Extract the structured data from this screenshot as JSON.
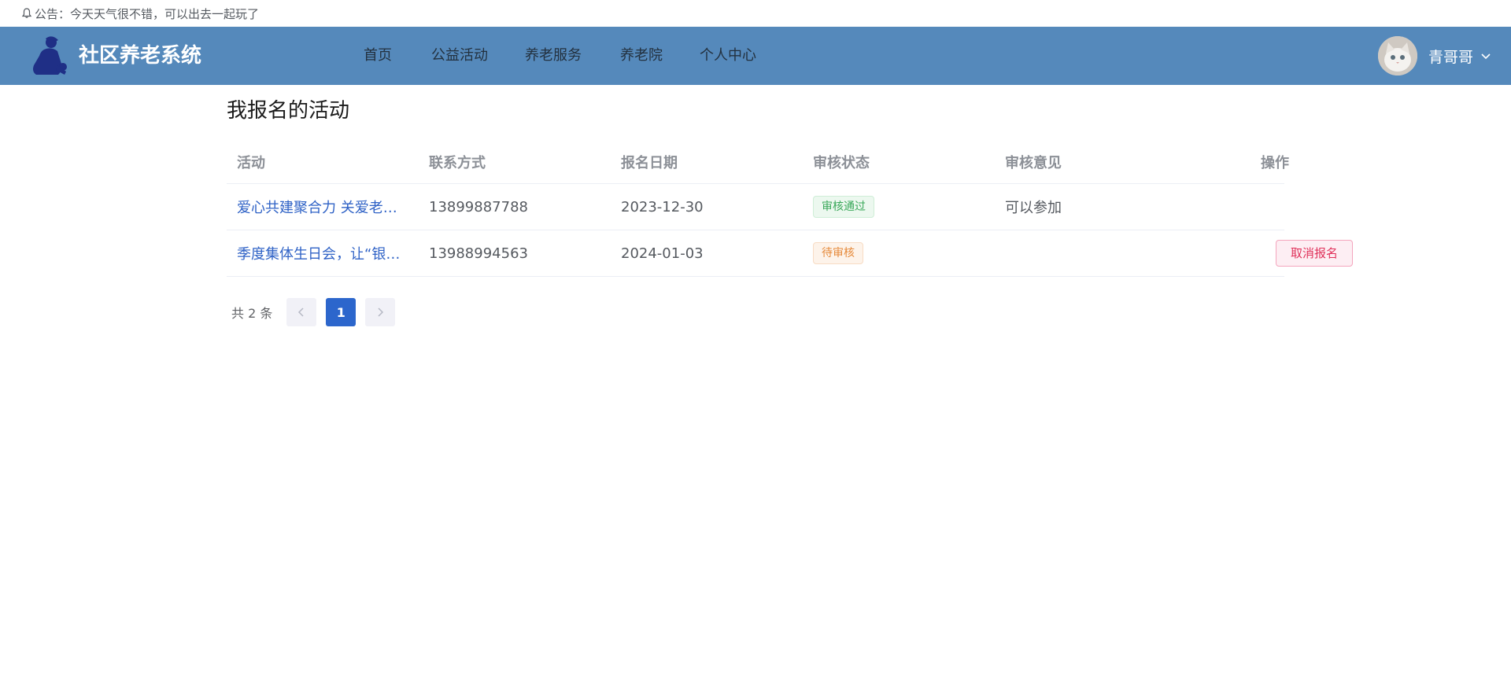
{
  "notice": {
    "prefix": "公告：",
    "text": "今天天气很不错，可以出去一起玩了"
  },
  "header": {
    "brand": "社区养老系统",
    "nav": [
      {
        "label": "首页"
      },
      {
        "label": "公益活动"
      },
      {
        "label": "养老服务"
      },
      {
        "label": "养老院"
      },
      {
        "label": "个人中心"
      }
    ],
    "user": {
      "name": "青哥哥"
    }
  },
  "main": {
    "title": "我报名的活动",
    "table": {
      "headers": [
        "活动",
        "联系方式",
        "报名日期",
        "审核状态",
        "审核意见",
        "操作"
      ],
      "rows": [
        {
          "activity": "爱心共建聚合力 关爱老人暖人心",
          "contact": "13899887788",
          "date": "2023-12-30",
          "status": "审核通过",
          "opinion": "可以参加",
          "action": ""
        },
        {
          "activity": "季度集体生日会，让“银发”老人们乐享幸福",
          "contact": "13988994563",
          "date": "2024-01-03",
          "status": "待审核",
          "opinion": "",
          "action": "取消报名"
        }
      ]
    },
    "pagination": {
      "total_label": "共 2 条",
      "current_page": "1"
    }
  },
  "colors": {
    "header_bg": "#5589bb",
    "link": "#2f62c6",
    "status_ok": "#3aa85a",
    "status_wait": "#e68a3b",
    "danger": "#e0315a",
    "pager_active": "#2c66cc"
  },
  "icons": {
    "notice": "bell-icon",
    "logo": "elder-caregiver-logo-icon",
    "user_menu": "chevron-down-icon",
    "prev": "chevron-left-icon",
    "next": "chevron-right-icon"
  }
}
